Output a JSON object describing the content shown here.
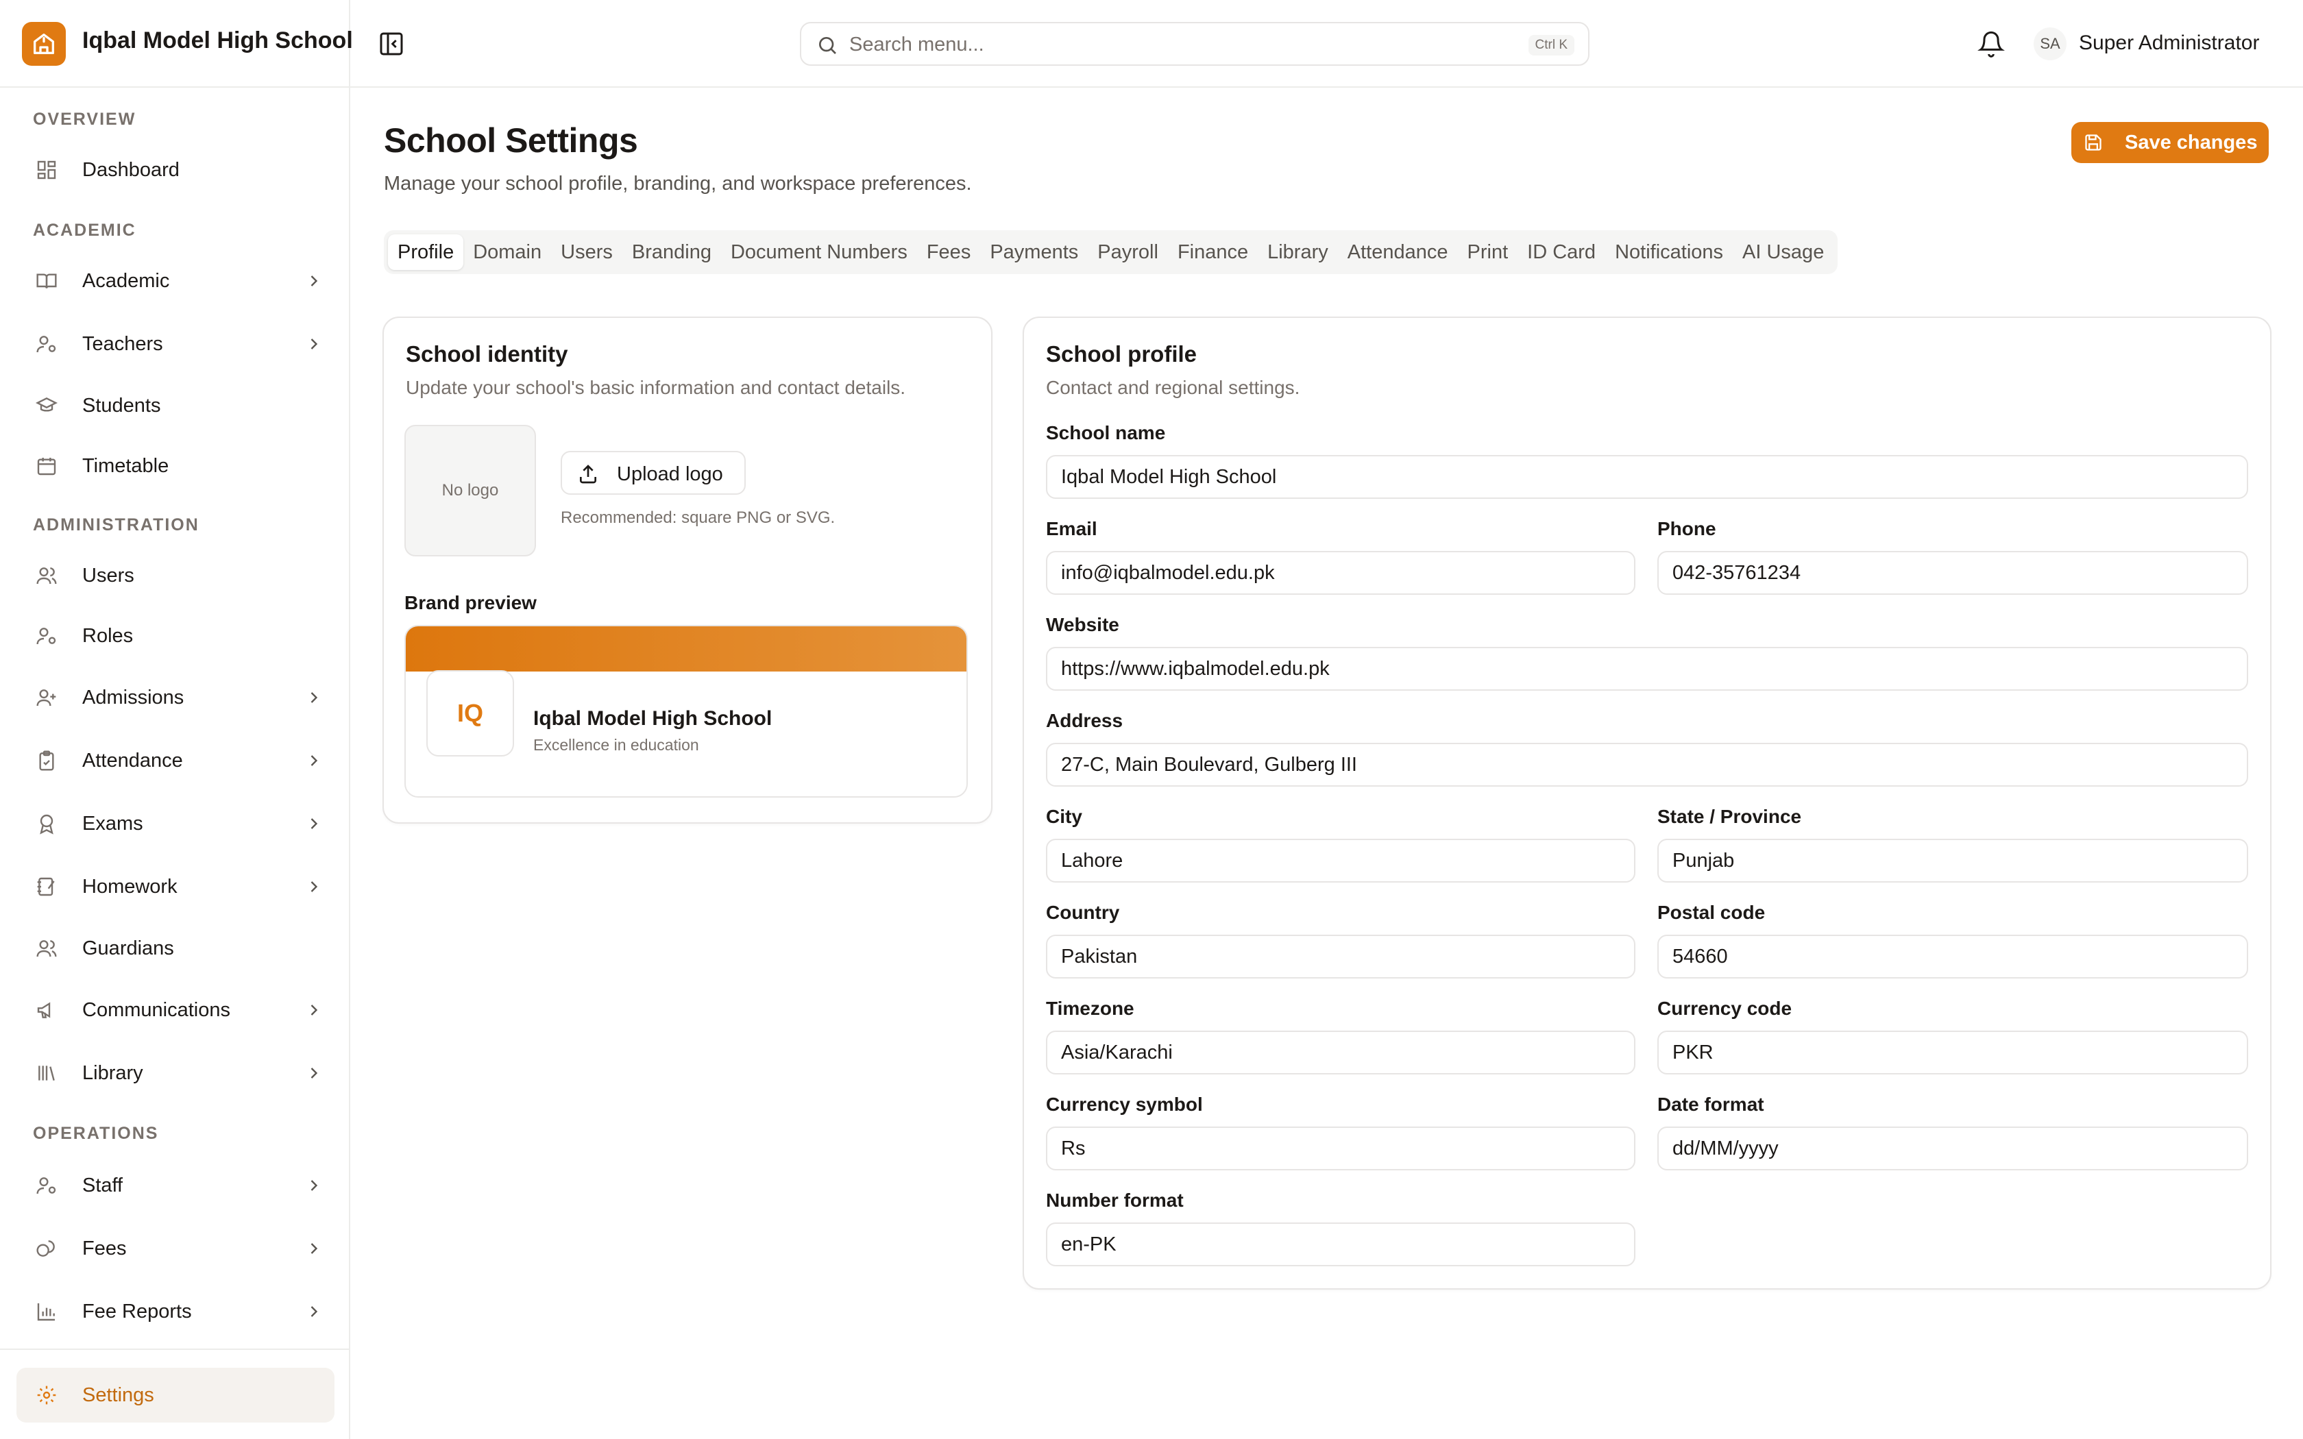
{
  "app": {
    "school_name": "Iqbal Model High School"
  },
  "topbar": {
    "search_placeholder": "Search menu...",
    "search_shortcut": "Ctrl K",
    "user_initials": "SA",
    "user_name": "Super Administrator"
  },
  "sidebar": {
    "sections": {
      "overview": "OVERVIEW",
      "academic": "ACADEMIC",
      "administration": "ADMINISTRATION",
      "operations": "OPERATIONS"
    },
    "items": {
      "dashboard": "Dashboard",
      "academic": "Academic",
      "teachers": "Teachers",
      "students": "Students",
      "timetable": "Timetable",
      "users": "Users",
      "roles": "Roles",
      "admissions": "Admissions",
      "attendance": "Attendance",
      "exams": "Exams",
      "homework": "Homework",
      "guardians": "Guardians",
      "communications": "Communications",
      "library": "Library",
      "staff": "Staff",
      "fees": "Fees",
      "fee_reports": "Fee Reports",
      "settings": "Settings"
    }
  },
  "page": {
    "title": "School Settings",
    "subtitle": "Manage your school profile, branding, and workspace preferences.",
    "save_label": "Save changes"
  },
  "tabs": [
    "Profile",
    "Domain",
    "Users",
    "Branding",
    "Document Numbers",
    "Fees",
    "Payments",
    "Payroll",
    "Finance",
    "Library",
    "Attendance",
    "Print",
    "ID Card",
    "Notifications",
    "AI Usage"
  ],
  "identity": {
    "title": "School identity",
    "subtitle": "Update your school's basic information and contact details.",
    "no_logo": "No logo",
    "upload_label": "Upload logo",
    "upload_hint": "Recommended: square PNG or SVG.",
    "brand_preview_label": "Brand preview",
    "preview_initials": "IQ",
    "preview_name": "Iqbal Model High School",
    "preview_tagline": "Excellence in education"
  },
  "profile": {
    "title": "School profile",
    "subtitle": "Contact and regional settings.",
    "fields": {
      "school_name": {
        "label": "School name",
        "value": "Iqbal Model High School"
      },
      "email": {
        "label": "Email",
        "value": "info@iqbalmodel.edu.pk"
      },
      "phone": {
        "label": "Phone",
        "value": "042-35761234"
      },
      "website": {
        "label": "Website",
        "value": "https://www.iqbalmodel.edu.pk"
      },
      "address": {
        "label": "Address",
        "value": "27-C, Main Boulevard, Gulberg III"
      },
      "city": {
        "label": "City",
        "value": "Lahore"
      },
      "state": {
        "label": "State / Province",
        "value": "Punjab"
      },
      "country": {
        "label": "Country",
        "value": "Pakistan"
      },
      "postal_code": {
        "label": "Postal code",
        "value": "54660"
      },
      "timezone": {
        "label": "Timezone",
        "value": "Asia/Karachi"
      },
      "currency_code": {
        "label": "Currency code",
        "value": "PKR"
      },
      "currency_symbol": {
        "label": "Currency symbol",
        "value": "Rs"
      },
      "date_format": {
        "label": "Date format",
        "value": "dd/MM/yyyy"
      },
      "number_format": {
        "label": "Number format",
        "value": "en-PK"
      }
    }
  },
  "colors": {
    "accent": "#e07a12",
    "border": "#e7e5e4",
    "muted_text": "#78716c"
  }
}
